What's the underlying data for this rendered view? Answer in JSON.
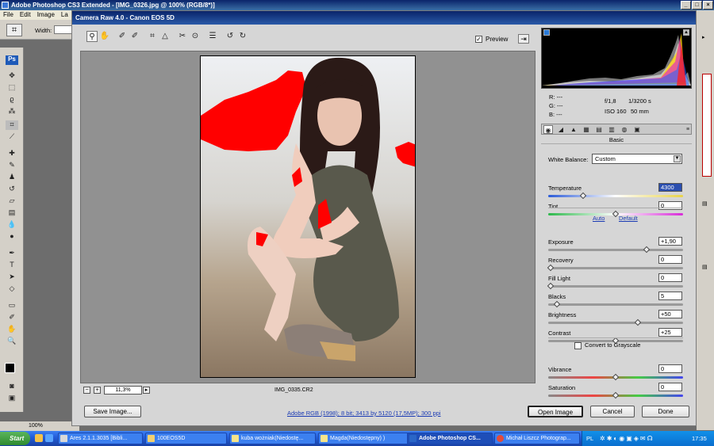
{
  "photoshop": {
    "title": "Adobe Photoshop CS3 Extended - [IMG_0326.jpg @ 100% (RGB/8*)]",
    "menu": [
      "File",
      "Edit",
      "Image",
      "La"
    ],
    "options": {
      "width_label": "Width:"
    },
    "status_zoom": "100%"
  },
  "camera_raw": {
    "title": "Camera Raw 4.0  -  Canon EOS 5D",
    "preview_label": "Preview",
    "preview_checked": true,
    "zoom_value": "11,3%",
    "filename": "IMG_0335.CR2",
    "info": {
      "r": "R:  ---",
      "g": "G:  ---",
      "b": "B:  ---",
      "aperture": "f/1,8",
      "shutter": "1/3200 s",
      "iso": "ISO 160",
      "focal": "50 mm"
    },
    "panel_title": "Basic",
    "white_balance_label": "White Balance:",
    "white_balance_value": "Custom",
    "auto_label": "Auto",
    "default_label": "Default",
    "convert_grayscale_label": "Convert to Grayscale",
    "sliders": [
      {
        "label": "Temperature",
        "value": "4300",
        "level": 0.25
      },
      {
        "label": "Tint",
        "value": "0",
        "level": 0.5
      },
      {
        "label": "Exposure",
        "value": "+1,90",
        "level": 0.74
      },
      {
        "label": "Recovery",
        "value": "0",
        "level": 0.0
      },
      {
        "label": "Fill Light",
        "value": "0",
        "level": 0.0
      },
      {
        "label": "Blacks",
        "value": "5",
        "level": 0.05
      },
      {
        "label": "Brightness",
        "value": "+50",
        "level": 0.67
      },
      {
        "label": "Contrast",
        "value": "+25",
        "level": 0.5
      },
      {
        "label": "Vibrance",
        "value": "0",
        "level": 0.5
      },
      {
        "label": "Saturation",
        "value": "0",
        "level": 0.5
      }
    ],
    "workflow_link": "Adobe RGB (1998); 8 bit; 3413 by 5120 (17,5MP); 300 ppi",
    "buttons": {
      "save": "Save Image...",
      "open": "Open Image",
      "cancel": "Cancel",
      "done": "Done"
    }
  },
  "taskbar": {
    "start": "Start",
    "tasks": [
      {
        "label": "Ares 2.1.1.3035  [Bibli..."
      },
      {
        "label": "100EOS5D"
      },
      {
        "label": "kuba wożniak(Niedostę..."
      },
      {
        "label": "Magda(Niedostępny)  )"
      },
      {
        "label": "Adobe Photoshop CS..."
      },
      {
        "label": "Michał Liszcz Photograp..."
      }
    ],
    "lang": "PL",
    "clock": "17:35"
  }
}
